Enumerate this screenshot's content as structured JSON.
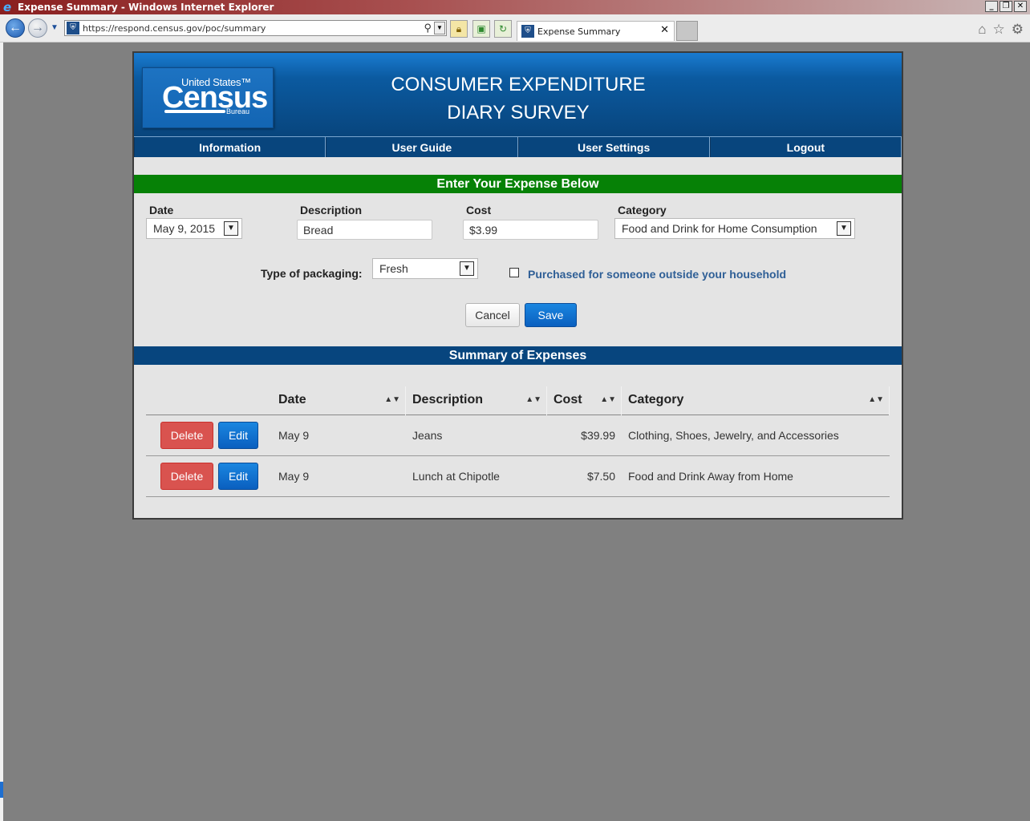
{
  "window": {
    "title": "Expense Summary - Windows Internet Explorer",
    "ie_glyph": "e",
    "minimize": "_",
    "restore": "❐",
    "close": "✕"
  },
  "browser": {
    "url": "https://respond.census.gov/poc/summary",
    "tab_label": "Expense Summary",
    "tab_close": "✕",
    "back_glyph": "←",
    "forward_glyph": "→",
    "dropdown_glyph": "▼",
    "home_icon": "⌂",
    "favorites_icon": "☆",
    "tools_icon": "⚙"
  },
  "header": {
    "logo_united_states": "United States™",
    "logo_census": "Census",
    "logo_bureau": "Bureau",
    "title_line1": "CONSUMER EXPENDITURE",
    "title_line2": "DIARY SURVEY"
  },
  "menu": {
    "items": [
      {
        "label": "Information"
      },
      {
        "label": "User Guide"
      },
      {
        "label": "User Settings"
      },
      {
        "label": "Logout"
      }
    ]
  },
  "entry": {
    "heading": "Enter Your Expense Below",
    "date_label": "Date",
    "date_value": "May 9, 2015",
    "description_label": "Description",
    "description_value": "Bread",
    "cost_label": "Cost",
    "cost_value": "$3.99",
    "category_label": "Category",
    "category_value": "Food and Drink for Home Consumption",
    "packaging_label": "Type of packaging:",
    "packaging_value": "Fresh",
    "outside_household_label": "Purchased for someone outside your household",
    "outside_household_checked": false,
    "cancel_label": "Cancel",
    "save_label": "Save"
  },
  "summary": {
    "heading": "Summary of Expenses",
    "columns": [
      "Date",
      "Description",
      "Cost",
      "Category"
    ],
    "sort_glyph": "▲▼",
    "delete_label": "Delete",
    "edit_label": "Edit",
    "rows": [
      {
        "date": "May 9",
        "description": "Jeans",
        "cost": "$39.99",
        "category": "Clothing, Shoes, Jewelry, and Accessories"
      },
      {
        "date": "May 9",
        "description": "Lunch at Chipotle",
        "cost": "$7.50",
        "category": "Food and Drink Away from Home"
      }
    ]
  },
  "colors": {
    "header_blue": "#08457d",
    "green_bar": "#068106",
    "delete_red": "#d9534f",
    "primary_blue": "#0a5fbf",
    "link_blue": "#2f5f96"
  }
}
